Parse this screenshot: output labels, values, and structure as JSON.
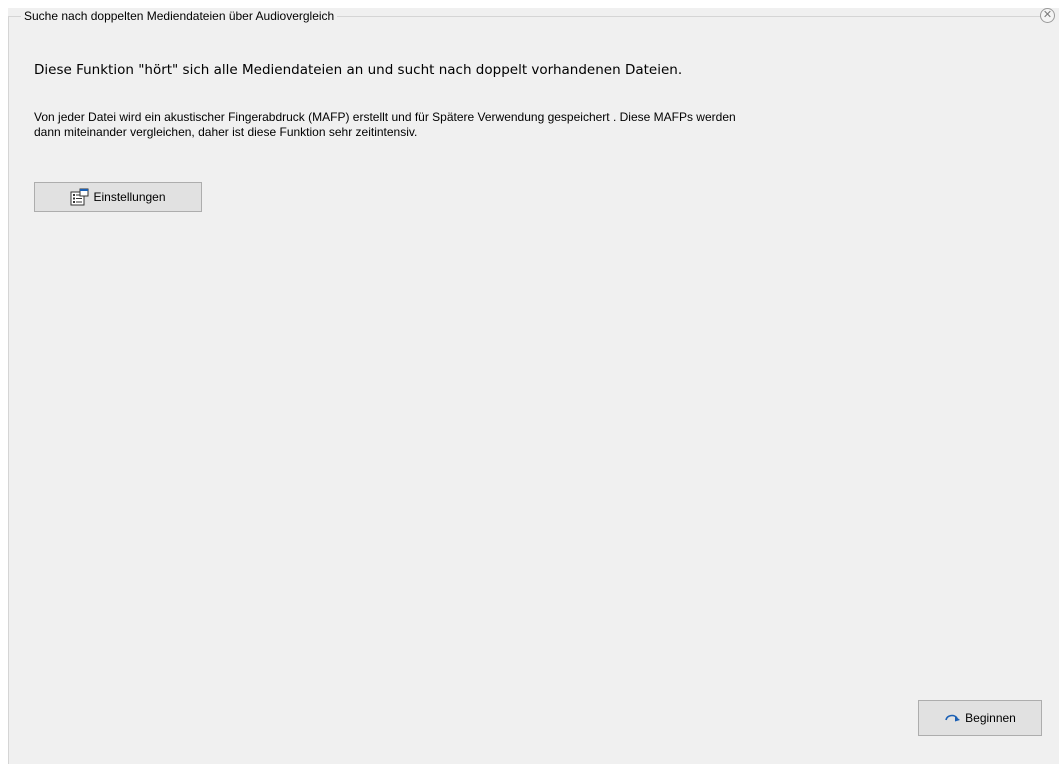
{
  "group": {
    "title": "Suche nach doppelten Mediendateien über Audiovergleich",
    "close_icon": "close-circle-icon",
    "close_glyph": "✕"
  },
  "content": {
    "headline": "Diese Funktion \"hört\" sich alle Mediendateien an und sucht nach doppelt vorhandenen Dateien.",
    "description_line1": "Von jeder Datei wird ein akustischer Fingerabdruck (MAFP) erstellt  und für Spätere Verwendung gespeichert . Diese MAFPs werden",
    "description_line2": "dann miteinander vergleichen, daher ist diese Funktion sehr zeitintensiv."
  },
  "buttons": {
    "settings_label": "Einstellungen",
    "settings_icon": "properties-icon",
    "start_label": "Beginnen",
    "start_icon": "redo-arrow-icon"
  },
  "colors": {
    "background": "#f0f0f0",
    "button_face": "#e1e1e1",
    "button_border": "#adadad",
    "icon_blue": "#1a5fb4"
  }
}
